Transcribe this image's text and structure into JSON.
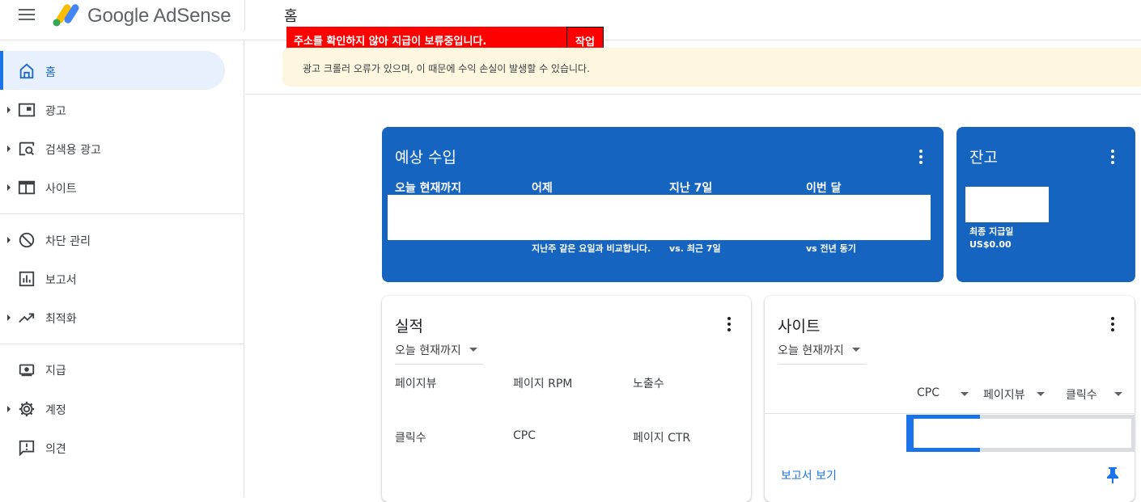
{
  "header": {
    "brand": "Google AdSense",
    "page_title": "홈"
  },
  "alert": {
    "message": "주소를 확인하지 않아 지급이 보류중입니다.",
    "action": "작업",
    "notice": "광고 크롤러 오류가 있으며, 이 때문에 수익 손실이 발생할 수 있습니다."
  },
  "sidebar": {
    "items": [
      {
        "label": "홈",
        "icon": "home-icon"
      },
      {
        "label": "광고",
        "icon": "ads-icon"
      },
      {
        "label": "검색용 광고",
        "icon": "search-ads-icon"
      },
      {
        "label": "사이트",
        "icon": "sites-icon"
      },
      {
        "label": "차단 관리",
        "icon": "block-icon"
      },
      {
        "label": "보고서",
        "icon": "reports-icon"
      },
      {
        "label": "최적화",
        "icon": "optimization-icon"
      },
      {
        "label": "지급",
        "icon": "payments-icon"
      },
      {
        "label": "계정",
        "icon": "gear-icon"
      },
      {
        "label": "의견",
        "icon": "feedback-icon"
      }
    ]
  },
  "earnings": {
    "title": "예상 수입",
    "columns": [
      {
        "label": "오늘 현재까지",
        "sub": ""
      },
      {
        "label": "어제",
        "sub": "지난주 같은 요일과 비교합니다."
      },
      {
        "label": "지난 7일",
        "sub": "vs. 최근 7일"
      },
      {
        "label": "이번 달",
        "sub": "vs 전년 동기"
      }
    ]
  },
  "balance": {
    "title": "잔고",
    "last_payment_label": "최종 지급일",
    "last_payment_value": "US$0.00"
  },
  "performance": {
    "title": "실적",
    "period": "오늘 현재까지",
    "metrics": [
      "페이지뷰",
      "페이지 RPM",
      "노출수",
      "클릭수",
      "CPC",
      "페이지 CTR"
    ]
  },
  "sites": {
    "title": "사이트",
    "period": "오늘 현재까지",
    "columns": [
      "CPC",
      "페이지뷰",
      "클릭수"
    ],
    "report_link": "보고서 보기"
  },
  "colors": {
    "card_blue": "#1565c0",
    "accent": "#1a73e8",
    "alert_red": "#ff0000",
    "notice_bg": "#fef7e0"
  }
}
